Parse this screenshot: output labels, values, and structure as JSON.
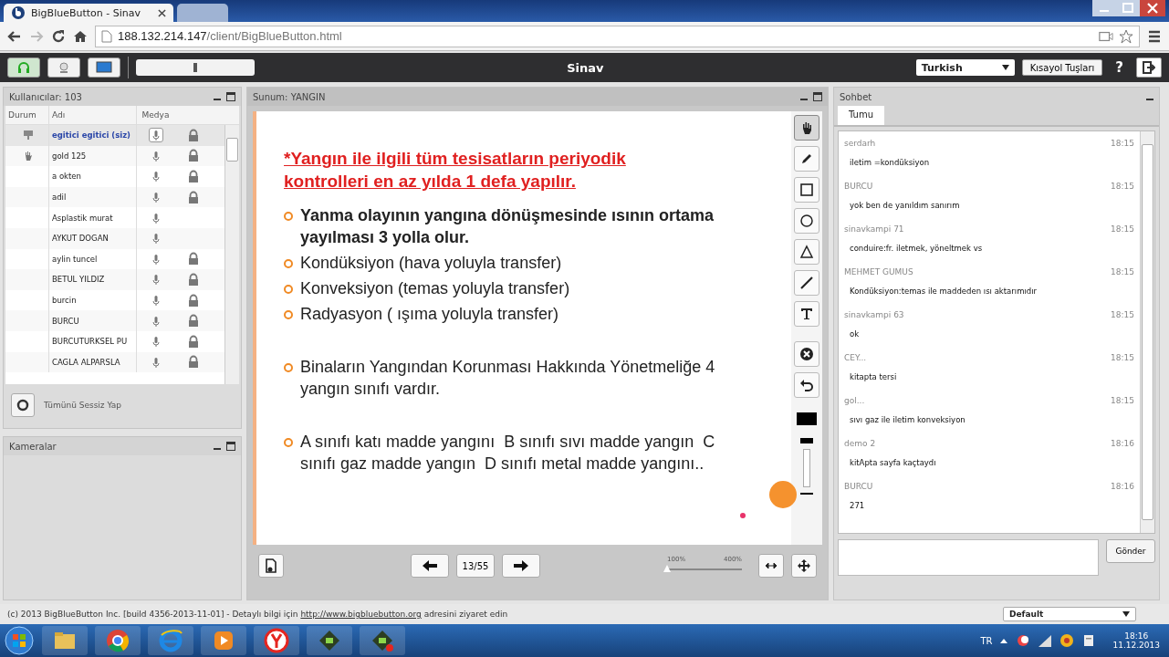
{
  "browser": {
    "tabs": [
      {
        "title": "BigBlueButton - Sinav",
        "selected": true
      },
      {
        "selected": false
      }
    ],
    "address": {
      "host": "188.132.214.147",
      "path": "/client/BigBlueButton.html"
    }
  },
  "toolbar": {
    "modules": [
      {
        "kind": "headset",
        "selected": true
      },
      {
        "kind": "webcam",
        "selected": false
      },
      {
        "kind": "desktop",
        "selected": false
      }
    ],
    "mic": {
      "level": 0.5
    },
    "title": "Sinav",
    "language": "Turkish",
    "shortcuts": "Kısayol Tuşları",
    "help": "?"
  },
  "users": {
    "title": "Kullanıcılar: 103",
    "columns": [
      "Durum",
      "Adı",
      "Medya"
    ],
    "rows": [
      {
        "kind": "presenter",
        "name": "egitici egitici (siz)",
        "selected": true,
        "locked": true
      },
      {
        "kind": "hand",
        "name": "gold 125",
        "selected": false,
        "locked": true
      },
      {
        "kind": "none",
        "name": "a okten",
        "selected": false,
        "locked": true
      },
      {
        "kind": "none",
        "name": "adil",
        "selected": false,
        "locked": true
      },
      {
        "kind": "none",
        "name": "Asplastik murat",
        "selected": false,
        "locked": false
      },
      {
        "kind": "none",
        "name": "AYKUT DOGAN",
        "selected": false,
        "locked": false
      },
      {
        "kind": "none",
        "name": "aylin tuncel",
        "selected": false,
        "locked": true
      },
      {
        "kind": "none",
        "name": "BETUL YILDIZ",
        "selected": false,
        "locked": true
      },
      {
        "kind": "none",
        "name": "burcin",
        "selected": false,
        "locked": true
      },
      {
        "kind": "none",
        "name": "BURCU",
        "selected": false,
        "locked": true
      },
      {
        "kind": "none",
        "name": "BURCUTURKSEL PU",
        "selected": false,
        "locked": true
      },
      {
        "kind": "none",
        "name": "CAGLA ALPARSLA",
        "selected": false,
        "locked": true
      }
    ],
    "mute_all": "Tümünü Sessiz Yap"
  },
  "cameras": {
    "title": "Kameralar"
  },
  "presentation": {
    "title": "Sunum: YANGIN",
    "slide_title": "*Yangın ile ilgili tüm tesisatların periyodik kontrolleri en az yılda 1 defa yapılır.",
    "groups": [
      [
        {
          "text": "Yanma olayının yangına dönüşmesinde ısının ortama yayılması 3 yolla olur.",
          "kind": "bold"
        },
        {
          "text": "Kondüksiyon (hava yoluyla transfer)",
          "kind": "normal"
        },
        {
          "text": "Konveksiyon (temas yoluyla transfer)",
          "kind": "normal"
        },
        {
          "text": "Radyasyon ( ışıma yoluyla transfer)",
          "kind": "normal"
        }
      ],
      [
        {
          "text": "Binaların Yangından Korunması Hakkında Yönetmeliğe 4 yangın sınıfı vardır.",
          "kind": "normal"
        }
      ],
      [
        {
          "text": "A sınıfı katı madde yangını  B sınıfı sıvı madde yangın  C sınıfı gaz madde yangın  D sınıfı metal madde yangını..",
          "kind": "normal"
        }
      ]
    ],
    "tools": [
      {
        "kind": "hand",
        "selected": true
      },
      {
        "kind": "pencil",
        "selected": false
      },
      {
        "kind": "rectangle",
        "selected": false
      },
      {
        "kind": "ellipse",
        "selected": false
      },
      {
        "kind": "triangle",
        "selected": false
      },
      {
        "kind": "line",
        "selected": false
      },
      {
        "kind": "text",
        "selected": false
      },
      {
        "kind": "clear",
        "selected": false
      },
      {
        "kind": "undo",
        "selected": false
      }
    ],
    "page": "13/55",
    "zoom_min": "100%",
    "zoom_max": "400%",
    "zoom": {
      "level": 0
    }
  },
  "chat": {
    "title": "Sohbet",
    "tabs": [
      {
        "label": "Tumu",
        "selected": true
      }
    ],
    "messages": [
      {
        "name": "serdarh",
        "time": "18:15",
        "text": "iletim =kondüksiyon"
      },
      {
        "name": "BURCU",
        "time": "18:15",
        "text": "yok ben de yanıldım sanırım"
      },
      {
        "name": "sinavkampi 71",
        "time": "18:15",
        "text": "conduire:fr. iletmek, yöneltmek vs"
      },
      {
        "name": "MEHMET GUMUS",
        "time": "18:15",
        "text": "Kondüksiyon:temas ile maddeden ısı aktarımıdır"
      },
      {
        "name": "sinavkampi 63",
        "time": "18:15",
        "text": "ok"
      },
      {
        "name": "CEY...",
        "time": "18:15",
        "text": "kitapta tersi"
      },
      {
        "name": "gol...",
        "time": "18:15",
        "text": "sıvı gaz ile iletim konveksiyon"
      },
      {
        "name": "demo 2",
        "time": "18:16",
        "text": "kitApta sayfa kaçtaydı"
      },
      {
        "name": "BURCU",
        "time": "18:16",
        "text": "271"
      }
    ],
    "send": "Gönder"
  },
  "footer": {
    "text": "(c) 2013 BigBlueButton Inc. [build 4356-2013-11-01] - Detaylı bilgi için",
    "link": "http://www.bigbluebutton.org",
    "after": "adresini ziyaret edin",
    "layout": "Default"
  },
  "taskbar": {
    "apps": [
      {
        "kind": "folder"
      },
      {
        "kind": "chrome"
      },
      {
        "kind": "ie"
      },
      {
        "kind": "media"
      },
      {
        "kind": "yandex"
      },
      {
        "kind": "app"
      },
      {
        "kind": "app-rec"
      }
    ],
    "lang": "TR",
    "time": "18:16",
    "date": "11.12.2013"
  }
}
